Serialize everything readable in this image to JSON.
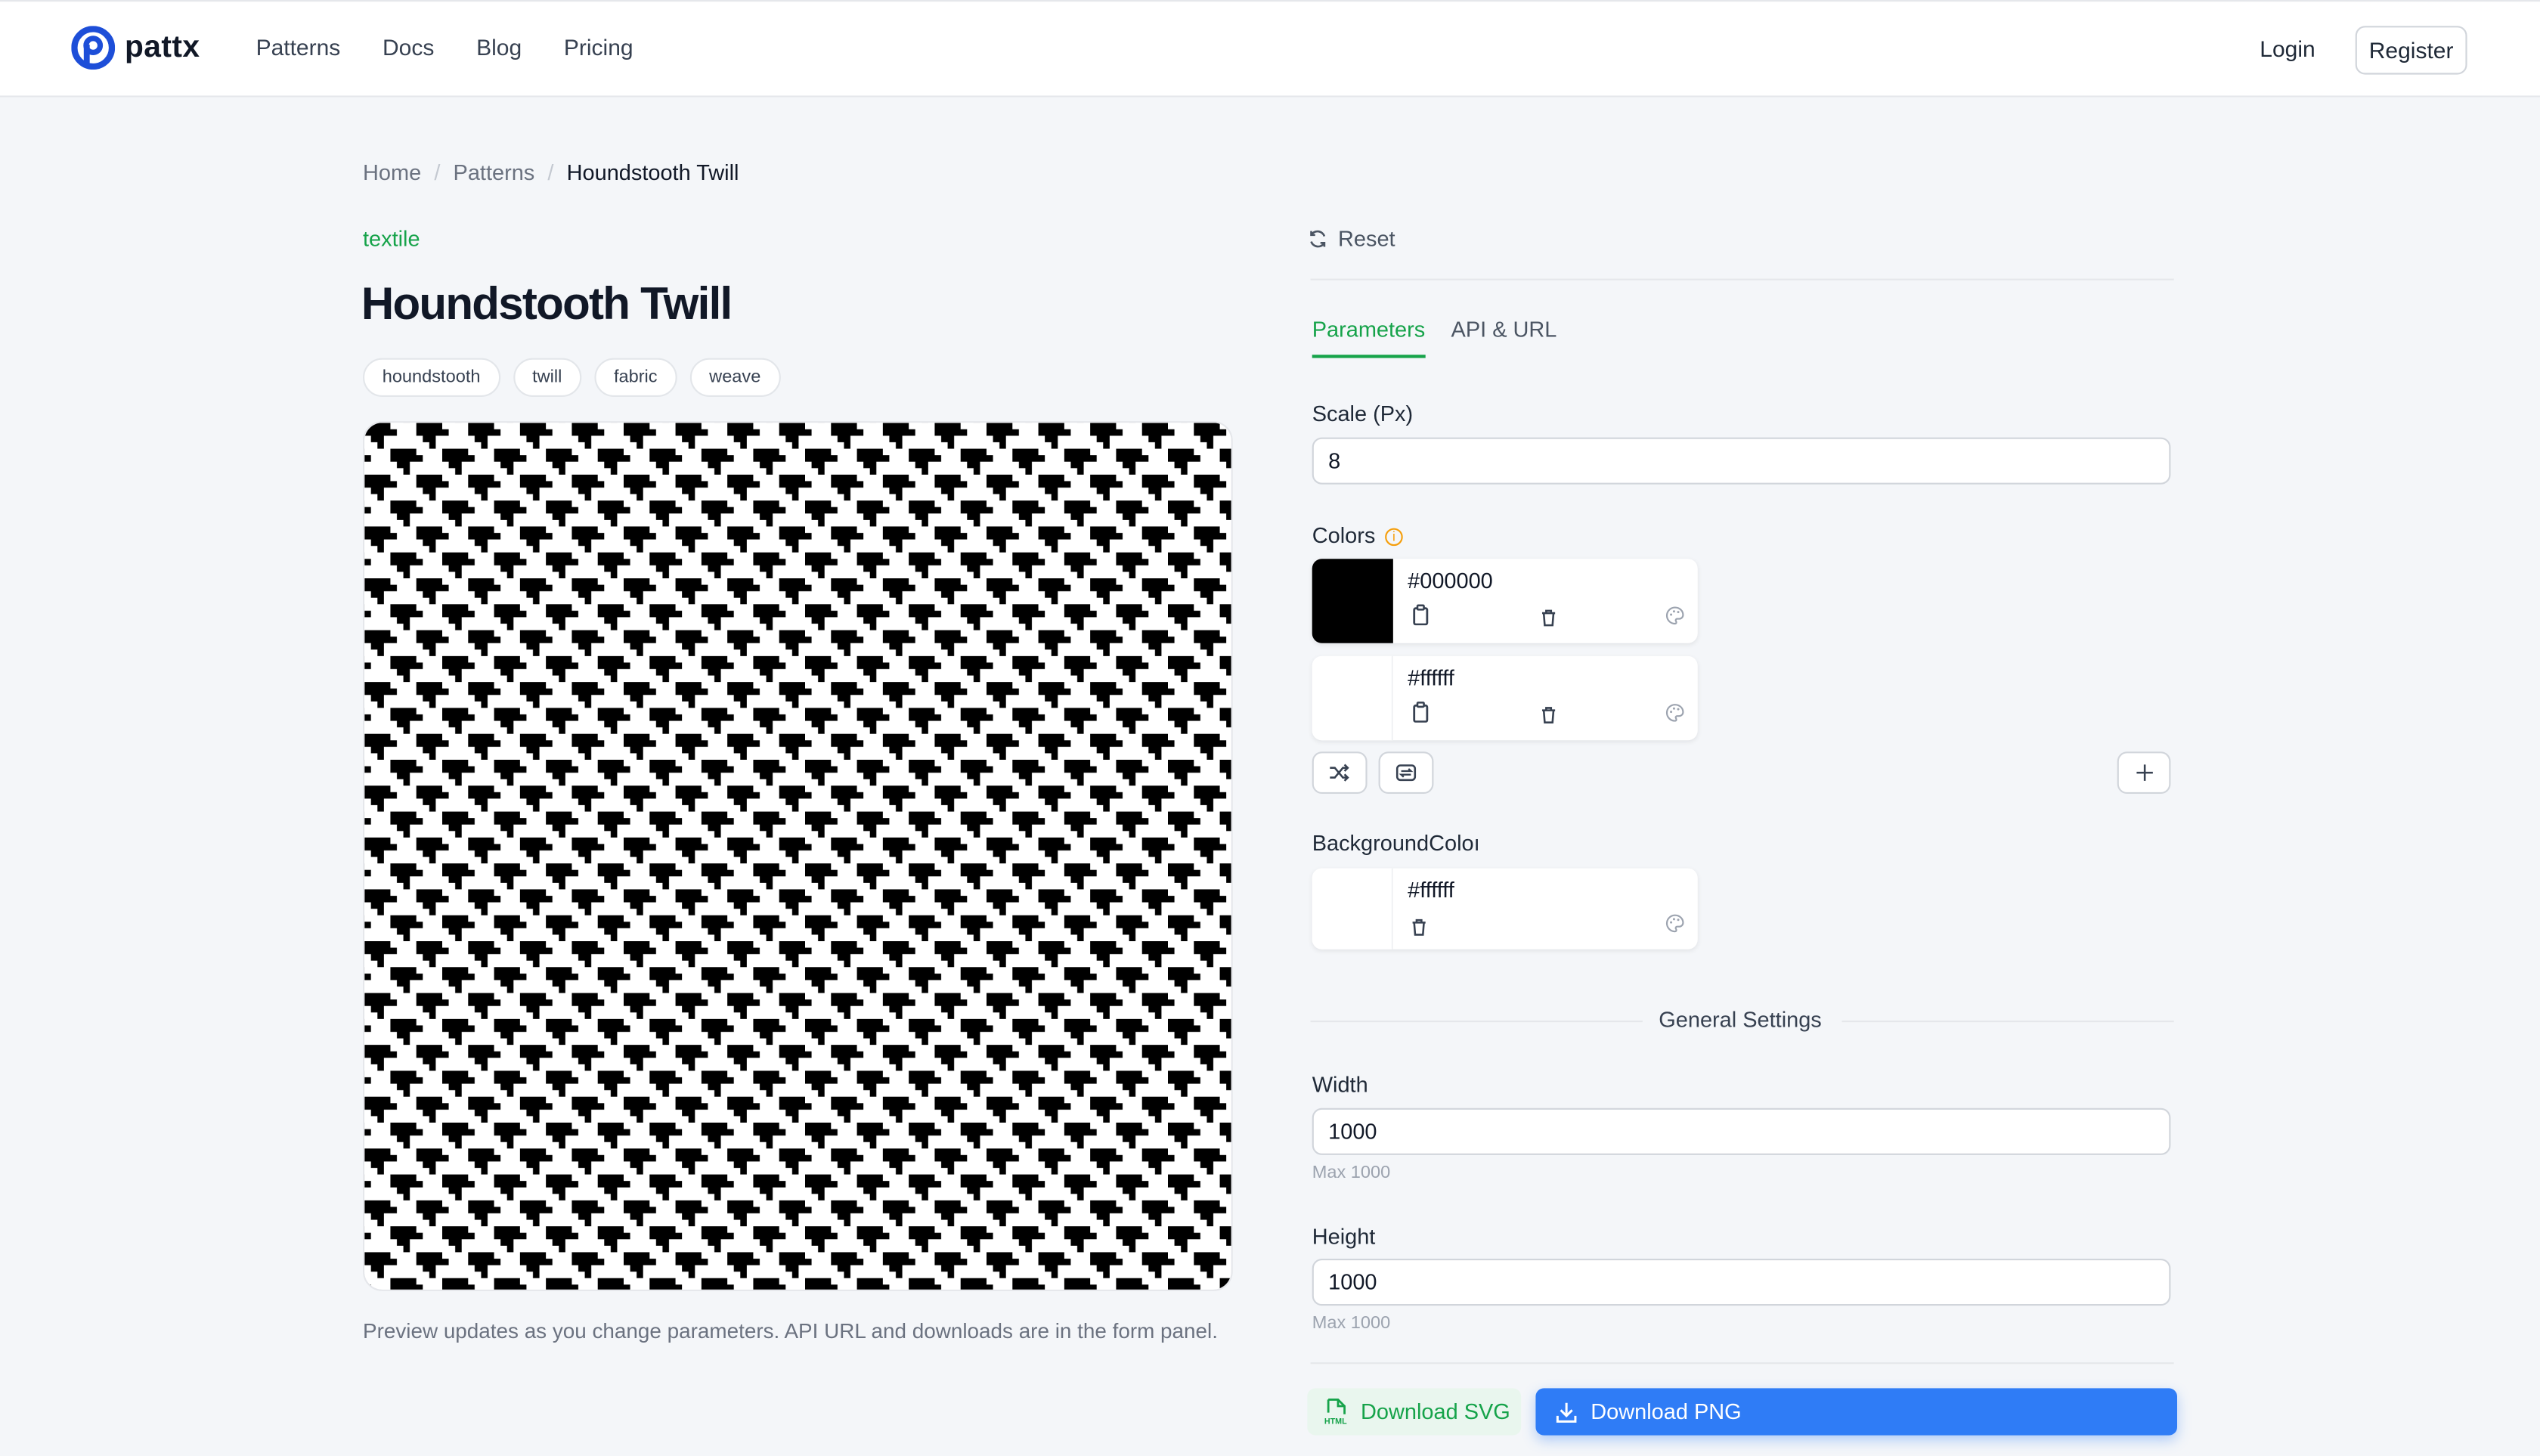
{
  "brand": {
    "name": "pattx",
    "accent": "#16a34a",
    "primary": "#2f7cf6",
    "logo_color": "#1d4ed8"
  },
  "nav": {
    "items": [
      "Patterns",
      "Docs",
      "Blog",
      "Pricing"
    ],
    "login": "Login",
    "register": "Register"
  },
  "breadcrumb": {
    "items": [
      "Home",
      "Patterns",
      "Houndstooth Twill"
    ],
    "separator": "/"
  },
  "pattern": {
    "category": "textile",
    "title": "Houndstooth Twill",
    "tags": [
      "houndstooth",
      "twill",
      "fabric",
      "weave"
    ],
    "caption": "Preview updates as you change parameters. API URL and downloads are in the form panel."
  },
  "panel": {
    "reset": "Reset",
    "tabs": [
      "Parameters",
      "API & URL"
    ],
    "active_tab": "Parameters",
    "scale": {
      "label": "Scale (Px)",
      "value": "8"
    },
    "colors": {
      "label": "Colors",
      "items": [
        "#000000",
        "#ffffff"
      ]
    },
    "background": {
      "label": "BackgroundColoı",
      "value": "#ffffff"
    },
    "general_settings": "General Settings",
    "width": {
      "label": "Width",
      "value": "1000",
      "hint": "Max 1000"
    },
    "height": {
      "label": "Height",
      "value": "1000",
      "hint": "Max 1000"
    },
    "download_svg": "Download SVG",
    "download_png": "Download PNG",
    "svg_badge": "HTML"
  },
  "icons": {
    "logo": "logo-icon",
    "reset": "refresh-icon",
    "info": "info-icon",
    "copy": "copy-icon",
    "trash": "trash-icon",
    "palette": "palette-icon",
    "shuffle": "shuffle-icon",
    "swap": "swap-icon",
    "add": "plus-icon",
    "file": "file-code-icon",
    "download": "download-icon"
  }
}
